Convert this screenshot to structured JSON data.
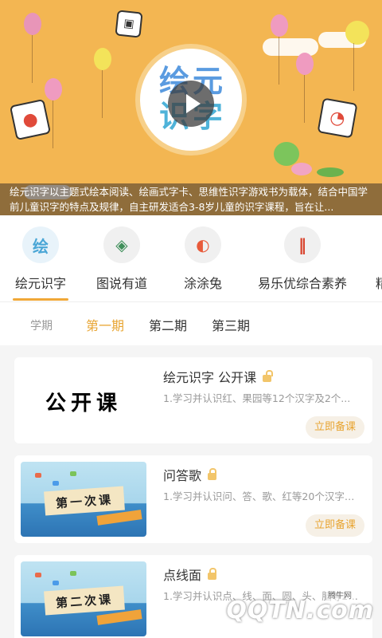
{
  "banner": {
    "status_time": "",
    "logo_line1": "绘元",
    "logo_line2": "识字",
    "description": "绘元识字以主题式绘本阅读、绘画式字卡、思维性识字游戏书为载体，结合中国学前儿童识字的特点及规律，自主研发适合3-8岁儿童的识字课程，旨在让..."
  },
  "categories": [
    {
      "label": "绘元识字",
      "icon": "绘",
      "icon_name": "huiyuan-logo-icon",
      "active": true,
      "color": "#4aa6d6"
    },
    {
      "label": "图说有道",
      "icon": "◈",
      "icon_name": "tushuo-logo-icon",
      "color": "#3f8f5a"
    },
    {
      "label": "涂涂兔",
      "icon": "◐",
      "icon_name": "tututu-logo-icon",
      "color": "#e85a3a"
    },
    {
      "label": "易乐优综合素养",
      "icon": "‖",
      "icon_name": "yileyou-logo-icon",
      "color": "#d8432d"
    },
    {
      "label": "精",
      "icon": "",
      "icon_name": "partial-category-icon",
      "color": "#999"
    }
  ],
  "terms": {
    "label": "学期",
    "items": [
      {
        "label": "第一期",
        "active": true
      },
      {
        "label": "第二期"
      },
      {
        "label": "第三期"
      }
    ]
  },
  "lessons": [
    {
      "title": "绘元识字 公开课",
      "desc": "1.学习并认识红、果园等12个汉字及2个...",
      "thumb_text": "公开课",
      "thumb_type": "open",
      "lock": "unlocked",
      "button": "立即备课"
    },
    {
      "title": "问答歌",
      "desc": "1.学习并认识问、答、歌、红等20个汉字及...",
      "thumb_text": "第一次课",
      "thumb_type": "art",
      "lock": "locked",
      "button": "立即备课"
    },
    {
      "title": "点线面",
      "desc": "1.学习并认识点、线、面、圆、头、脑等23...",
      "thumb_text": "第二次课",
      "thumb_type": "art",
      "lock": "locked",
      "button": ""
    }
  ],
  "watermark": {
    "logo": "QQTN.com",
    "sub": "腾牛网"
  },
  "colors": {
    "accent": "#e8a533",
    "banner_bg": "#f3b652"
  }
}
